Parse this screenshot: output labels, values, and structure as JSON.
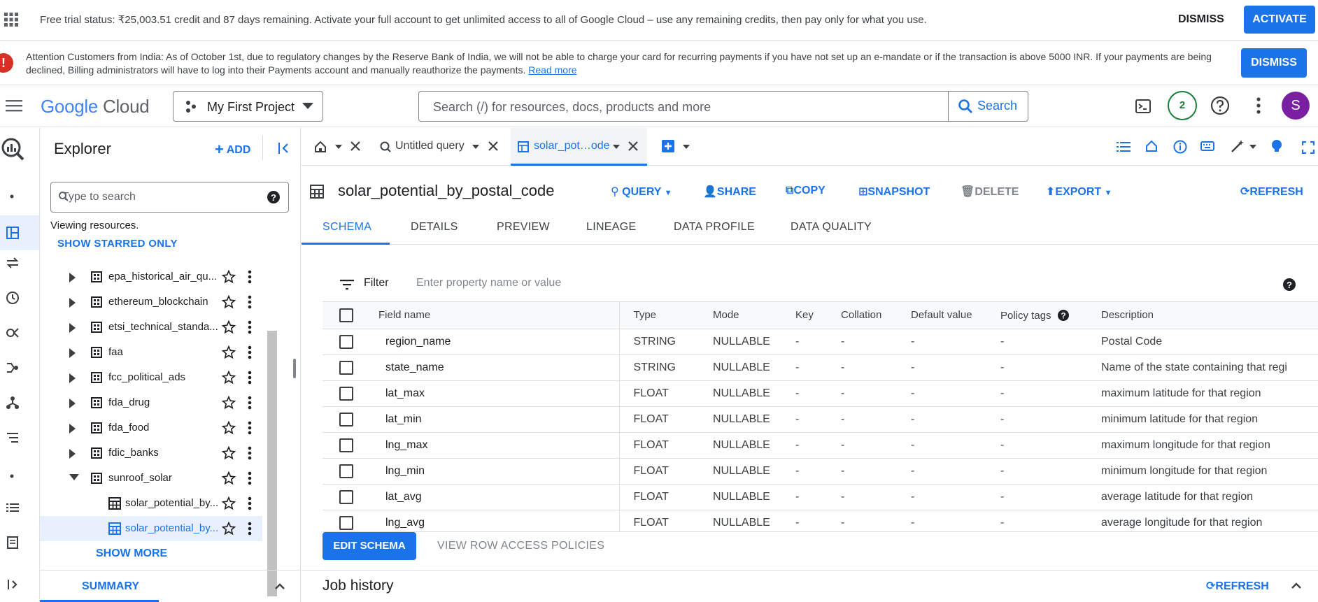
{
  "trial_banner": {
    "message": "Free trial status: ₹25,003.51 credit and 87 days remaining. Activate your full account to get unlimited access to all of Google Cloud – use any remaining credits, then pay only for what you use.",
    "dismiss_label": "DISMISS",
    "activate_label": "ACTIVATE"
  },
  "india_banner": {
    "message": "Attention Customers from India: As of October 1st, due to regulatory changes by the Reserve Bank of India, we will not be able to charge your card for recurring payments if you have not set up an e-mandate or if the transaction is above 5000 INR. If your payments are being declined, Billing administrators will have to log into their Payments account and manually reauthorize the payments.",
    "link_label": "Read more",
    "dismiss_label": "DISMISS"
  },
  "topbar": {
    "logo_google": "Google",
    "logo_cloud": "Cloud",
    "project_name": "My First Project",
    "search_placeholder": "Search (/) for resources, docs, products and more",
    "search_button": "Search",
    "notifications_count": "2",
    "avatar_letter": "S"
  },
  "explorer": {
    "title": "Explorer",
    "add_label": "ADD",
    "search_placeholder": "Type to search",
    "viewing_text": "Viewing resources.",
    "show_starred_label": "SHOW STARRED ONLY",
    "items": [
      {
        "label": "epa_historical_air_qu...",
        "type": "dataset",
        "expanded": false
      },
      {
        "label": "ethereum_blockchain",
        "type": "dataset",
        "expanded": false
      },
      {
        "label": "etsi_technical_standa...",
        "type": "dataset",
        "expanded": false
      },
      {
        "label": "faa",
        "type": "dataset",
        "expanded": false
      },
      {
        "label": "fcc_political_ads",
        "type": "dataset",
        "expanded": false
      },
      {
        "label": "fda_drug",
        "type": "dataset",
        "expanded": false
      },
      {
        "label": "fda_food",
        "type": "dataset",
        "expanded": false
      },
      {
        "label": "fdic_banks",
        "type": "dataset",
        "expanded": false
      },
      {
        "label": "sunroof_solar",
        "type": "dataset",
        "expanded": true
      },
      {
        "label": "solar_potential_by...",
        "type": "table",
        "selected": false
      },
      {
        "label": "solar_potential_by...",
        "type": "table",
        "selected": true
      }
    ],
    "show_more_label": "SHOW MORE",
    "summary_label": "SUMMARY"
  },
  "query_tabs": [
    {
      "label": "",
      "icon": "home-icon"
    },
    {
      "label": "Untitled query",
      "icon": "query-icon"
    },
    {
      "label": "solar_pot…ode",
      "icon": "table-icon",
      "active": true
    }
  ],
  "table_header": {
    "name": "solar_potential_by_postal_code",
    "actions": {
      "query": "QUERY",
      "share": "SHARE",
      "copy": "COPY",
      "snapshot": "SNAPSHOT",
      "delete": "DELETE",
      "export": "EXPORT",
      "refresh": "REFRESH"
    }
  },
  "subtabs": [
    "SCHEMA",
    "DETAILS",
    "PREVIEW",
    "LINEAGE",
    "DATA PROFILE",
    "DATA QUALITY"
  ],
  "filter": {
    "label": "Filter",
    "placeholder": "Enter property name or value"
  },
  "schema": {
    "columns": [
      "Field name",
      "Type",
      "Mode",
      "Key",
      "Collation",
      "Default value",
      "Policy tags",
      "Description"
    ],
    "rows": [
      [
        "region_name",
        "STRING",
        "NULLABLE",
        "-",
        "-",
        "-",
        "-",
        "Postal Code"
      ],
      [
        "state_name",
        "STRING",
        "NULLABLE",
        "-",
        "-",
        "-",
        "-",
        "Name of the state containing that regi"
      ],
      [
        "lat_max",
        "FLOAT",
        "NULLABLE",
        "-",
        "-",
        "-",
        "-",
        "maximum latitude for that region"
      ],
      [
        "lat_min",
        "FLOAT",
        "NULLABLE",
        "-",
        "-",
        "-",
        "-",
        "minimum latitude for that region"
      ],
      [
        "lng_max",
        "FLOAT",
        "NULLABLE",
        "-",
        "-",
        "-",
        "-",
        "maximum longitude for that region"
      ],
      [
        "lng_min",
        "FLOAT",
        "NULLABLE",
        "-",
        "-",
        "-",
        "-",
        "minimum longitude for that region"
      ],
      [
        "lat_avg",
        "FLOAT",
        "NULLABLE",
        "-",
        "-",
        "-",
        "-",
        "average latitude for that region"
      ],
      [
        "lng_avg",
        "FLOAT",
        "NULLABLE",
        "-",
        "-",
        "-",
        "-",
        "average longitude for that region"
      ]
    ]
  },
  "footer": {
    "edit_schema_label": "EDIT SCHEMA",
    "view_row_access_label": "VIEW ROW ACCESS POLICIES"
  },
  "job_history": {
    "title": "Job history",
    "refresh_label": "REFRESH"
  },
  "colors": {
    "accent": "#1a73e8",
    "selected_bg": "#e8f0fe",
    "alert": "#d93025",
    "badge": "#188038",
    "avatar": "#7b1fa2"
  }
}
